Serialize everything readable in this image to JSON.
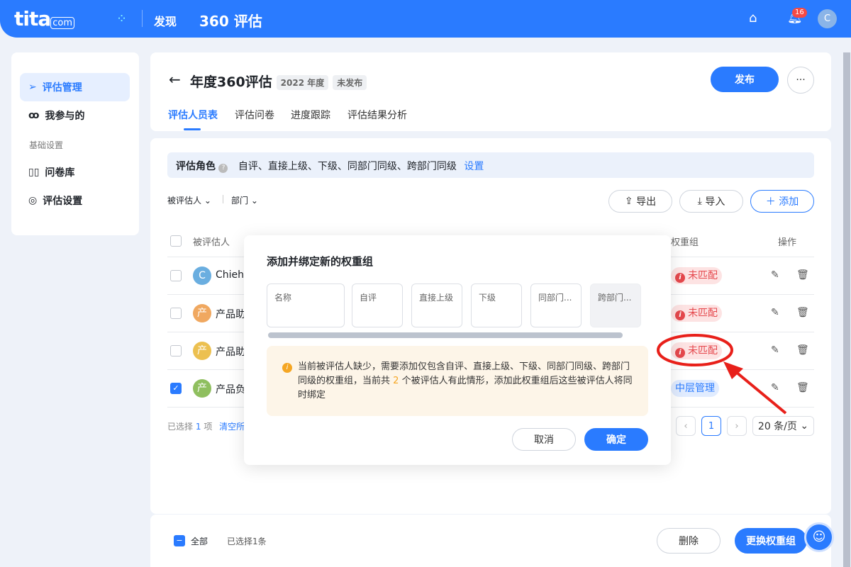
{
  "topbar": {
    "logo": "tita",
    "logo_suffix": "com",
    "nav_discover": "发现",
    "app_title": "360 评估",
    "notification_count": "16",
    "user_initial": "C"
  },
  "sidebar": {
    "items": [
      {
        "label": "评估管理",
        "icon": "paper-plane-icon",
        "active": true
      },
      {
        "label": "我参与的",
        "icon": "users-icon"
      }
    ],
    "section": "基础设置",
    "settings": [
      {
        "label": "问卷库",
        "icon": "library-icon"
      },
      {
        "label": "评估设置",
        "icon": "settings-icon"
      }
    ]
  },
  "header": {
    "title": "年度360评估",
    "year_tag": "2022 年度",
    "status_tag": "未发布",
    "publish": "发布",
    "more": "···",
    "tabs": [
      "评估人员表",
      "评估问卷",
      "进度跟踪",
      "评估结果分析"
    ]
  },
  "roles": {
    "label": "评估角色",
    "value": "自评、直接上级、下级、同部门同级、跨部门同级",
    "link": "设置"
  },
  "filters": {
    "evaluatee": "被评估人",
    "department": "部门"
  },
  "actions": {
    "export": "导出",
    "import": "导入",
    "add": "添加"
  },
  "table": {
    "headers": {
      "evaluatee": "被评估人",
      "weight_group": "权重组",
      "ops": "操作"
    },
    "rows": [
      {
        "initial": "C",
        "name": "Chieh",
        "avatar_color": "#6aaee0",
        "group": "未匹配",
        "matched": false,
        "checked": false
      },
      {
        "initial": "产",
        "name": "产品助",
        "avatar_color": "#f0a860",
        "group": "未匹配",
        "matched": false,
        "checked": false
      },
      {
        "initial": "产",
        "name": "产品助",
        "avatar_color": "#ecc050",
        "group": "未匹配",
        "matched": false,
        "checked": false
      },
      {
        "initial": "产",
        "name": "产品负",
        "avatar_color": "#8fbf5f",
        "group": "中层管理",
        "matched": true,
        "checked": true
      }
    ]
  },
  "selection": {
    "text_prefix": "已选择",
    "count": "1",
    "text_suffix": "项",
    "clear": "清空所"
  },
  "pagination": {
    "current": "1",
    "page_size": "20 条/页"
  },
  "modal": {
    "title": "添加并绑定新的权重组",
    "columns": [
      "名称",
      "自评",
      "直接上级",
      "下级",
      "同部门...",
      "跨部门..."
    ],
    "warning_part1": "当前被评估人缺少，需要添加仅包含自评、直接上级、下级、同部门同级、跨部门同级的权重组，当前共",
    "warning_count": "2",
    "warning_part2": "个被评估人有此情形，添加此权重组后这些被评估人将同时绑定",
    "cancel": "取消",
    "confirm": "确定"
  },
  "footer": {
    "all": "全部",
    "selected": "已选择1条",
    "delete": "删除",
    "change_group": "更换权重组"
  },
  "colors": {
    "primary": "#2a7bff",
    "danger": "#e5484d",
    "warning": "#f5a623"
  }
}
